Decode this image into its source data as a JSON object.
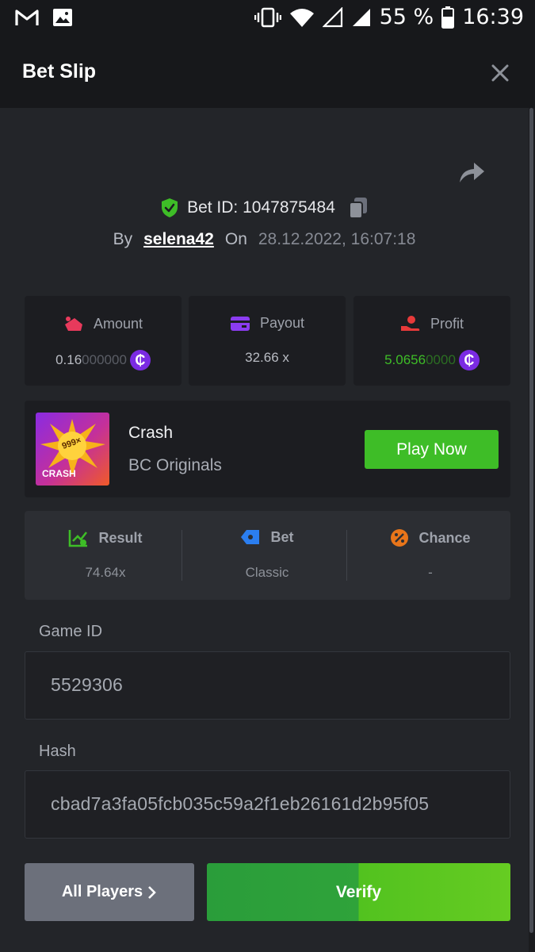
{
  "status_bar": {
    "battery": "55 %",
    "time": "16:39"
  },
  "header": {
    "title": "Bet Slip"
  },
  "bet": {
    "id_label": "Bet ID: 1047875484",
    "by_label": "By",
    "username": "selena42",
    "on_label": "On",
    "datetime": "28.12.2022, 16:07:18"
  },
  "stats": {
    "amount": {
      "label": "Amount",
      "value_bright": "0.16",
      "value_dim": "000000",
      "coin": "₵"
    },
    "payout": {
      "label": "Payout",
      "value": "32.66 x"
    },
    "profit": {
      "label": "Profit",
      "value_bright": "5.0656",
      "value_dim": "0000",
      "coin": "₵"
    }
  },
  "game": {
    "thumb_badge": "999×",
    "thumb_label": "CRASH",
    "name": "Crash",
    "provider": "BC Originals",
    "play_label": "Play Now"
  },
  "result": {
    "result_label": "Result",
    "result_value": "74.64x",
    "bet_label": "Bet",
    "bet_value": "Classic",
    "chance_label": "Chance",
    "chance_value": "-"
  },
  "fields": {
    "game_id_label": "Game ID",
    "game_id_value": "5529306",
    "hash_label": "Hash",
    "hash_value": "cbad7a3fa05fcb035c59a2f1eb26161d2b95f05"
  },
  "buttons": {
    "all_players": "All Players",
    "verify": "Verify"
  },
  "colors": {
    "accent_green": "#3ebd27",
    "profit_green": "#3ebd27",
    "coin_purple": "#7b2be3",
    "background": "#232529"
  }
}
